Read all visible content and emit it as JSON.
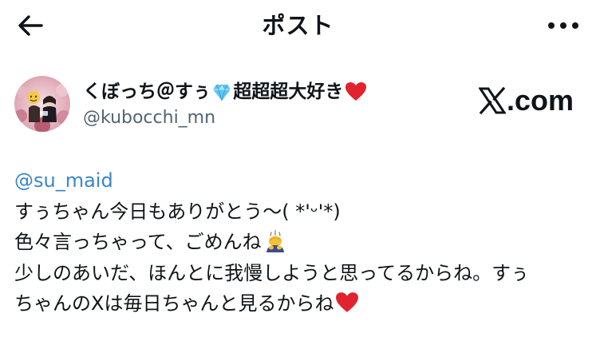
{
  "header": {
    "back_icon": "arrow-left-icon",
    "title": "ポスト",
    "more_icon": "more-horizontal-icon"
  },
  "author": {
    "display_name_part1": "くぼっち＠すぅ",
    "display_name_part2": "超超超大好き",
    "gem_icon": "gem-icon",
    "heart_icon": "red-heart-icon",
    "handle": "@kubocchi_mn"
  },
  "brand": {
    "logo_icon": "x-logo-icon",
    "suffix": ".com"
  },
  "tweet": {
    "mention": "@su_maid",
    "line1": "すぅちゃん今日もありがとう〜( *'ᵕ'*)",
    "line2": "色々言っちゃって、ごめんね",
    "line3": "少しのあいだ、ほんとに我慢しようと思ってるからね。すぅ",
    "line4": "ちゃんのXは毎日ちゃんと見るからね",
    "line2_emoji": "bowing-person-icon",
    "line4_emoji": "red-heart-icon"
  },
  "colors": {
    "text": "#0f1419",
    "secondary": "#536471",
    "mention": "#3a86c8",
    "heart": "#e0232e"
  }
}
